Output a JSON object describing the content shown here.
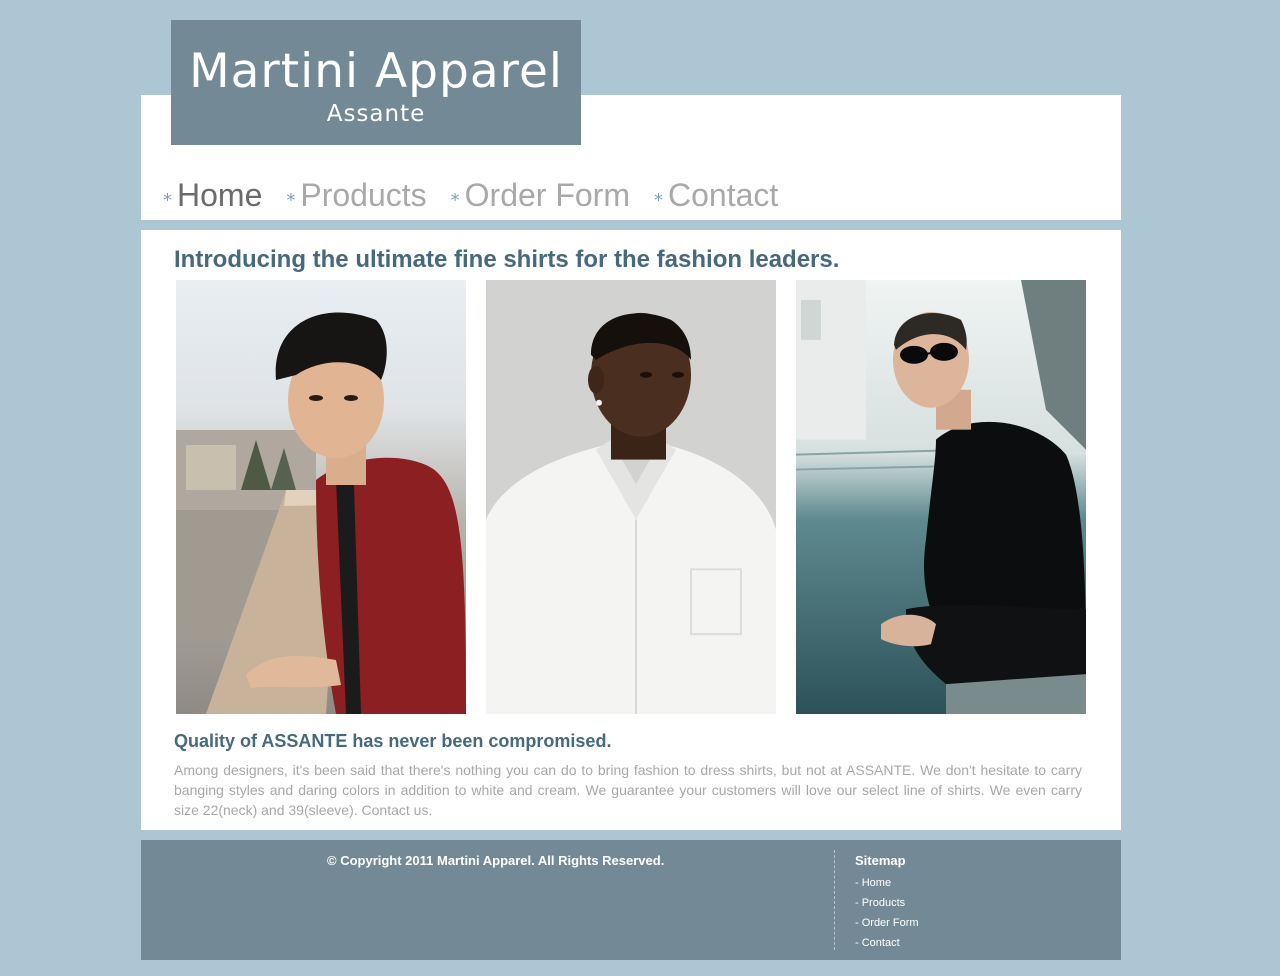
{
  "brand": {
    "title": "Martini Apparel",
    "subtitle": "Assante"
  },
  "nav": {
    "items": [
      {
        "label": "Home",
        "active": true
      },
      {
        "label": "Products",
        "active": false
      },
      {
        "label": "Order Form",
        "active": false
      },
      {
        "label": "Contact",
        "active": false
      }
    ],
    "bullet_icon": "asterisk-icon"
  },
  "main": {
    "intro": "Introducing the ultimate fine shirts for the fashion leaders.",
    "photos": [
      {
        "name": "model-red-shirt-photo"
      },
      {
        "name": "model-white-shirt-photo"
      },
      {
        "name": "model-black-shirt-photo"
      }
    ],
    "quality_heading": "Quality of ASSANTE has never been compromised.",
    "body": "Among designers, it's been said that there's nothing you can do to bring fashion to dress shirts, but not at ASSANTE. We don't hesitate to carry banging styles and daring colors in addition to white and cream. We guarantee your customers will love our select line of shirts. We even carry size 22(neck) and 39(sleeve). Contact us."
  },
  "footer": {
    "copyright": "© Copyright 2011 Martini Apparel. All Rights Reserved.",
    "sitemap_title": "Sitemap",
    "sitemap_links": [
      "- Home",
      "- Products",
      "- Order Form",
      "- Contact"
    ]
  },
  "colors": {
    "background": "#adc6d3",
    "brand_box": "#738a96",
    "heading": "#47697d",
    "nav_inactive": "#a9a9a9",
    "nav_active": "#6b6b6b"
  }
}
